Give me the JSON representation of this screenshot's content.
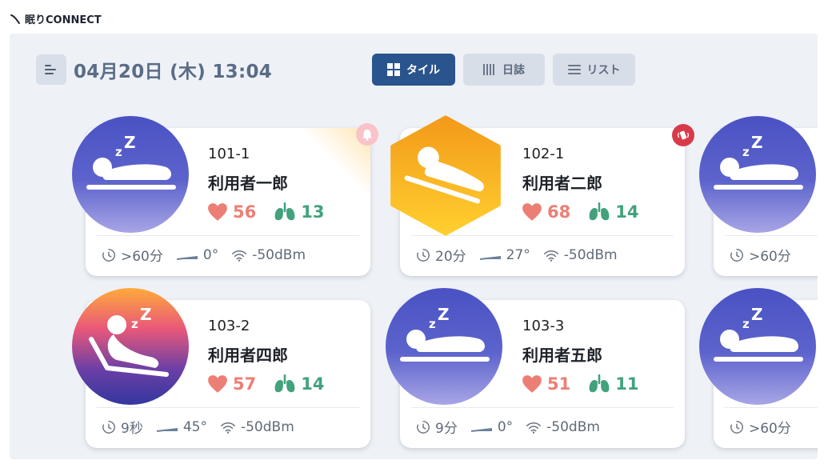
{
  "app": {
    "brand": "眠りCONNECT"
  },
  "header": {
    "date_text": "04月20日 (木) 13:04"
  },
  "view_tabs": {
    "tile": "タイル",
    "diary": "日誌",
    "list": "リスト",
    "active": "tile"
  },
  "colors": {
    "accent": "#29548d",
    "heart": "#ec7f75",
    "lung": "#41a27c",
    "sleep_avatar": [
      "#4f58c7",
      "#9d9ee3"
    ],
    "awake_hexagon": [
      "#f7a21b",
      "#ffc92e"
    ],
    "sunset_avatar": [
      "#ff9e44",
      "#d44a7a",
      "#3b3aa8"
    ],
    "alert_red": "#d93a4a",
    "alert_pink": "#f4a6b0"
  },
  "residents": [
    {
      "room": "101-1",
      "name": "利用者一郎",
      "heart_rate": "56",
      "resp_rate": "13",
      "duration": ">60分",
      "angle": "0°",
      "signal": "-50dBm",
      "state_icon": "sleeping-icon",
      "alert": "bell-icon"
    },
    {
      "room": "102-1",
      "name": "利用者二郎",
      "heart_rate": "68",
      "resp_rate": "14",
      "duration": "20分",
      "angle": "27°",
      "signal": "-50dBm",
      "state_icon": "awake-icon",
      "alert": "vibrating-phone-icon"
    },
    {
      "duration": ">60分",
      "state_icon": "sleeping-icon"
    },
    {
      "room": "103-2",
      "name": "利用者四郎",
      "heart_rate": "57",
      "resp_rate": "14",
      "duration": "9秒",
      "angle": "45°",
      "signal": "-50dBm",
      "state_icon": "sleeping-reclined-icon"
    },
    {
      "room": "103-3",
      "name": "利用者五郎",
      "heart_rate": "51",
      "resp_rate": "11",
      "duration": "9分",
      "angle": "0°",
      "signal": "-50dBm",
      "state_icon": "sleeping-icon"
    },
    {
      "duration": ">60分",
      "state_icon": "sleeping-icon"
    }
  ]
}
